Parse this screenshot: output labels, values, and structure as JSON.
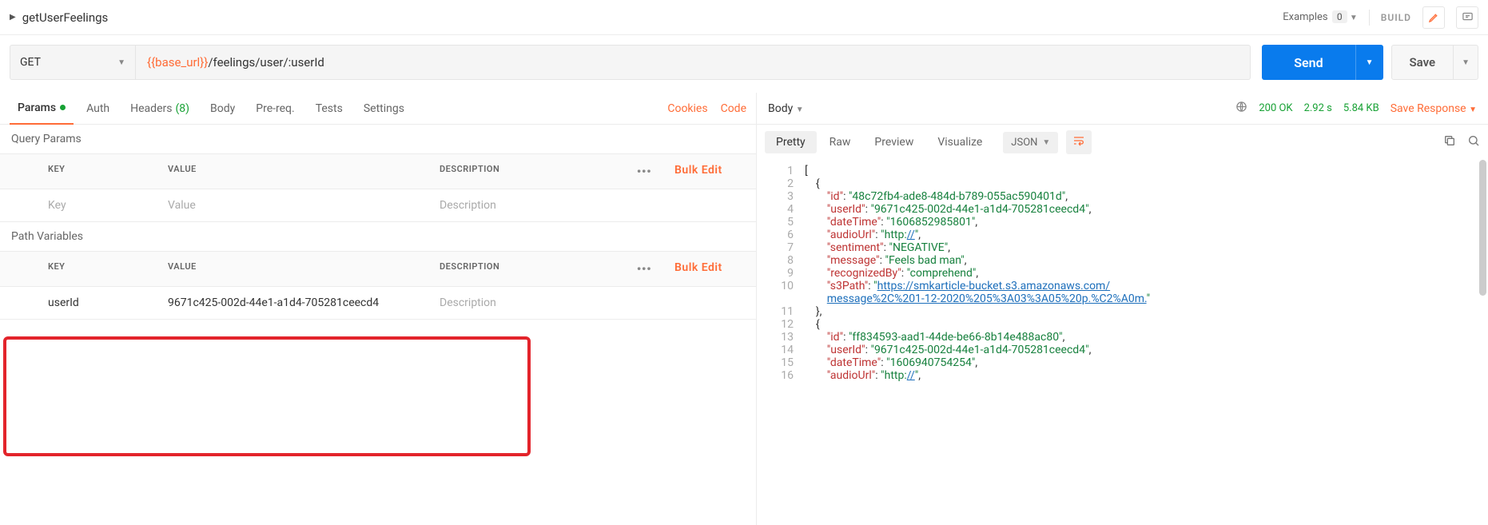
{
  "header": {
    "name": "getUserFeelings",
    "examples_label": "Examples",
    "examples_count": "0",
    "build": "BUILD"
  },
  "request": {
    "method": "GET",
    "url_var": "{{base_url}}",
    "url_path": "/feelings/user/:userId",
    "send": "Send",
    "save": "Save"
  },
  "tabs": {
    "params": "Params",
    "auth": "Auth",
    "headers": "Headers",
    "headers_count": "(8)",
    "body": "Body",
    "prereq": "Pre-req.",
    "tests": "Tests",
    "settings": "Settings",
    "cookies": "Cookies",
    "code": "Code"
  },
  "qp": {
    "title": "Query Params",
    "head_key": "KEY",
    "head_val": "VALUE",
    "head_desc": "DESCRIPTION",
    "bulk": "Bulk Edit",
    "ph_key": "Key",
    "ph_val": "Value",
    "ph_desc": "Description"
  },
  "pv": {
    "title": "Path Variables",
    "head_key": "KEY",
    "head_val": "VALUE",
    "head_desc": "DESCRIPTION",
    "bulk": "Bulk Edit",
    "row_key": "userId",
    "row_val": "9671c425-002d-44e1-a1d4-705281ceecd4",
    "row_desc_ph": "Description"
  },
  "resp": {
    "body": "Body",
    "status": "200 OK",
    "time": "2.92 s",
    "size": "5.84 KB",
    "save": "Save Response",
    "tab_pretty": "Pretty",
    "tab_raw": "Raw",
    "tab_preview": "Preview",
    "tab_vis": "Visualize",
    "type": "JSON"
  },
  "json_lines": [
    {
      "n": "1",
      "html": "<span class='j-pun'>[</span>"
    },
    {
      "n": "2",
      "html": "    <span class='j-pun'>{</span>"
    },
    {
      "n": "3",
      "html": "        <span class='j-key'>\"id\"</span><span class='j-pun'>: </span><span class='j-str'>\"48c72fb4-ade8-484d-b789-055ac590401d\"</span><span class='j-pun'>,</span>"
    },
    {
      "n": "4",
      "html": "        <span class='j-key'>\"userId\"</span><span class='j-pun'>: </span><span class='j-str'>\"9671c425-002d-44e1-a1d4-705281ceecd4\"</span><span class='j-pun'>,</span>"
    },
    {
      "n": "5",
      "html": "        <span class='j-key'>\"dateTime\"</span><span class='j-pun'>: </span><span class='j-str'>\"1606852985801\"</span><span class='j-pun'>,</span>"
    },
    {
      "n": "6",
      "html": "        <span class='j-key'>\"audioUrl\"</span><span class='j-pun'>: </span><span class='j-str'>\"http:</span><span class='j-link'>//</span><span class='j-str'>\"</span><span class='j-pun'>,</span>"
    },
    {
      "n": "7",
      "html": "        <span class='j-key'>\"sentiment\"</span><span class='j-pun'>: </span><span class='j-str'>\"NEGATIVE\"</span><span class='j-pun'>,</span>"
    },
    {
      "n": "8",
      "html": "        <span class='j-key'>\"message\"</span><span class='j-pun'>: </span><span class='j-str'>\"Feels bad man\"</span><span class='j-pun'>,</span>"
    },
    {
      "n": "9",
      "html": "        <span class='j-key'>\"recognizedBy\"</span><span class='j-pun'>: </span><span class='j-str'>\"comprehend\"</span><span class='j-pun'>,</span>"
    },
    {
      "n": "10",
      "html": "        <span class='j-key'>\"s3Path\"</span><span class='j-pun'>: </span><span class='j-str'>\"</span><span class='j-link'>https://smkarticle-bucket.s3.amazonaws.com/</span>"
    },
    {
      "n": "",
      "html": "        <span class='j-link'>message%2C%201-12-2020%205%3A03%3A05%20p.%C2%A0m.</span><span class='j-str'>\"</span>"
    },
    {
      "n": "11",
      "html": "    <span class='j-pun'>},</span>"
    },
    {
      "n": "12",
      "html": "    <span class='j-pun'>{</span>"
    },
    {
      "n": "13",
      "html": "        <span class='j-key'>\"id\"</span><span class='j-pun'>: </span><span class='j-str'>\"ff834593-aad1-44de-be66-8b14e488ac80\"</span><span class='j-pun'>,</span>"
    },
    {
      "n": "14",
      "html": "        <span class='j-key'>\"userId\"</span><span class='j-pun'>: </span><span class='j-str'>\"9671c425-002d-44e1-a1d4-705281ceecd4\"</span><span class='j-pun'>,</span>"
    },
    {
      "n": "15",
      "html": "        <span class='j-key'>\"dateTime\"</span><span class='j-pun'>: </span><span class='j-str'>\"1606940754254\"</span><span class='j-pun'>,</span>"
    },
    {
      "n": "16",
      "html": "        <span class='j-key'>\"audioUrl\"</span><span class='j-pun'>: </span><span class='j-str'>\"http:</span><span class='j-link'>//</span><span class='j-str'>\"</span><span class='j-pun'>,</span>"
    }
  ]
}
